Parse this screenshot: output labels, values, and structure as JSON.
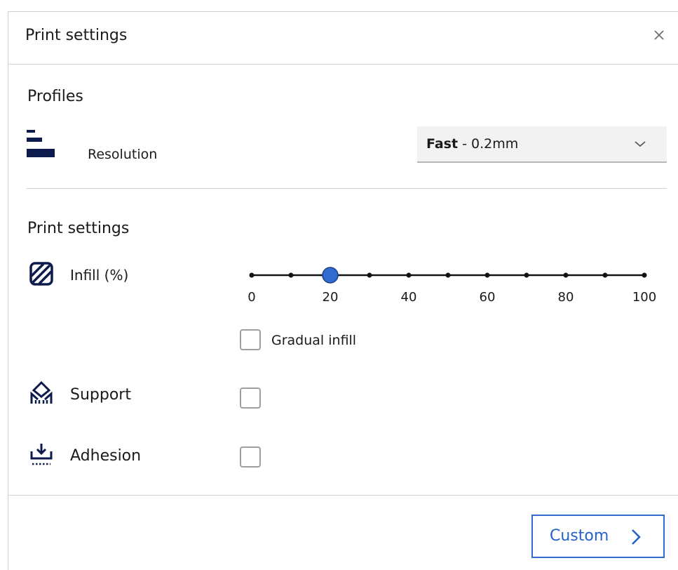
{
  "header": {
    "title": "Print settings",
    "close_icon": "close-icon"
  },
  "profiles": {
    "label": "Profiles",
    "resolution_label": "Resolution",
    "resolution_value_bold": "Fast",
    "resolution_value_rest": " - 0.2mm"
  },
  "print_settings": {
    "label": "Print settings",
    "infill": {
      "label": "Infill (%)",
      "value": 20,
      "min": 0,
      "max": 100,
      "ticks": [
        "0",
        "20",
        "40",
        "60",
        "80",
        "100"
      ],
      "gradual_label": "Gradual infill",
      "gradual_checked": false
    },
    "support": {
      "label": "Support",
      "checked": false
    },
    "adhesion": {
      "label": "Adhesion",
      "checked": false
    }
  },
  "footer": {
    "custom_label": "Custom"
  },
  "colors": {
    "accent": "#2f6bd1",
    "slider_handle": "#2f6bd1",
    "icon": "#0d1b4c"
  }
}
